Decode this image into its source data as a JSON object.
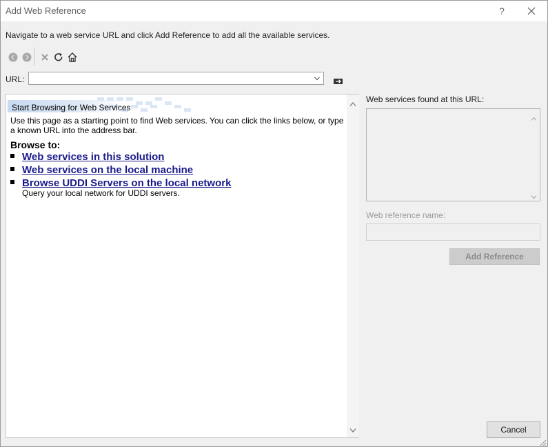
{
  "window": {
    "title": "Add Web Reference",
    "help_glyph": "?"
  },
  "instruction": "Navigate to a web service URL and click Add Reference to add all the available services.",
  "toolbar": {
    "icons": [
      "back-icon",
      "forward-icon",
      "stop-icon",
      "refresh-icon",
      "home-icon"
    ]
  },
  "url": {
    "label": "URL:",
    "value": "",
    "placeholder": ""
  },
  "browser": {
    "title": "Start Browsing for Web Services",
    "description": "Use this page as a starting point to find Web services. You can click the links below, or type a known URL into the address bar.",
    "browse_to": "Browse to:",
    "links": [
      {
        "label": "Web services in this solution"
      },
      {
        "label": "Web services on the local machine"
      },
      {
        "label": "Browse UDDI Servers on the local network",
        "sub": "Query your local network for UDDI servers."
      }
    ]
  },
  "results": {
    "found_label": "Web services found at this URL:",
    "ref_name_label": "Web reference name:",
    "ref_name_value": "",
    "add_reference": "Add Reference"
  },
  "footer": {
    "cancel": "Cancel"
  },
  "colors": {
    "link": "#1a1a8c",
    "background": "#f0f0f0",
    "disabled_text": "#8a8a8a"
  }
}
